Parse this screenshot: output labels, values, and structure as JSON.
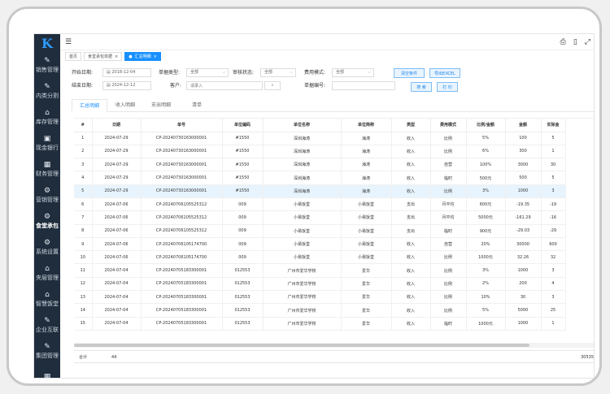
{
  "logo": "K",
  "sidebar": {
    "items": [
      {
        "label": "销售管理",
        "icon": "pen-icon"
      },
      {
        "label": "内类分割",
        "icon": "pen-icon"
      },
      {
        "label": "库存管理",
        "icon": "warehouse-icon"
      },
      {
        "label": "现金银行",
        "icon": "image-icon"
      },
      {
        "label": "财务管理",
        "icon": "calendar-icon"
      },
      {
        "label": "营销管理",
        "icon": "gear-icon"
      },
      {
        "label": "食堂承包",
        "icon": "gear-icon"
      },
      {
        "label": "系统设置",
        "icon": "gear-icon"
      },
      {
        "label": "夹层管理",
        "icon": "warehouse-icon"
      },
      {
        "label": "智慧饭堂",
        "icon": "warehouse-icon"
      },
      {
        "label": "企业互联",
        "icon": "pen-icon"
      },
      {
        "label": "集团管理",
        "icon": "pen-icon"
      },
      {
        "label": "",
        "icon": "grid-icon"
      }
    ]
  },
  "topbar": {
    "menu_icon": "☰",
    "print_icon": "⎙",
    "book_icon": "▯",
    "fullscreen_icon": "⤢"
  },
  "page_tabs": [
    {
      "label": "首页",
      "close": ""
    },
    {
      "label": "食堂承包单据",
      "close": "×"
    },
    {
      "label": "汇总明细",
      "close": "×",
      "dot": "●"
    }
  ],
  "filters": {
    "start_label": "开始日期:",
    "start_value": "2018-12-04",
    "end_label": "结束日期:",
    "end_value": "2024-12-12",
    "doctype_label": "单据类型:",
    "doctype_value": "全部",
    "customer_label": "客户:",
    "customer_placeholder": "请录入",
    "audit_label": "审核状态:",
    "audit_value": "全部",
    "fee_label": "费用模式:",
    "fee_value": "全部",
    "docno_label": "单据编号:",
    "clear_btn": "清空条件",
    "export_btn": "导出EXCEL",
    "search_btn": "搜 索",
    "print_btn": "打 印"
  },
  "subtabs": [
    "汇总明细",
    "收入明细",
    "支出明细",
    "清单"
  ],
  "table": {
    "headers": [
      "#",
      "日期",
      "单号",
      "单位编码",
      "单位名称",
      "单位简称",
      "类型",
      "费用模式",
      "比例/金额",
      "金额",
      "实际金"
    ],
    "rows": [
      [
        "1",
        "2024-07-29",
        "CP-20240730163000001",
        "#1550",
        "深圳海涛",
        "海涛",
        "收入",
        "比例",
        "5%",
        "100",
        "5"
      ],
      [
        "2",
        "2024-07-29",
        "CP-20240730163000001",
        "#1550",
        "深圳海涛",
        "海涛",
        "收入",
        "比例",
        "6%",
        "300",
        "1"
      ],
      [
        "3",
        "2024-07-29",
        "CP-20240730163000001",
        "#1550",
        "深圳海涛",
        "海涛",
        "收入",
        "自营",
        "100%",
        "3000",
        "30"
      ],
      [
        "4",
        "2024-07-29",
        "CP-20240730163000001",
        "#1550",
        "深圳海涛",
        "海涛",
        "收入",
        "临时",
        "500元",
        "500",
        "5"
      ],
      [
        "5",
        "2024-07-29",
        "CP-20240730163000001",
        "#1550",
        "深圳海涛",
        "海涛",
        "收入",
        "比例",
        "3%",
        "1000",
        "3"
      ],
      [
        "6",
        "2024-07-06",
        "CP-20240706105525312",
        "009",
        "小易饭堂",
        "小易饭堂",
        "支出",
        "月平均",
        "600元",
        "-19.35",
        "-19"
      ],
      [
        "7",
        "2024-07-06",
        "CP-20240706105525312",
        "009",
        "小易饭堂",
        "小易饭堂",
        "支出",
        "月平均",
        "5000元",
        "-161.29",
        "-16"
      ],
      [
        "8",
        "2024-07-06",
        "CP-20240706105525312",
        "009",
        "小易饭堂",
        "小易饭堂",
        "支出",
        "临时",
        "900元",
        "-29.03",
        "-29"
      ],
      [
        "9",
        "2024-07-06",
        "CP-20240706105174700",
        "009",
        "小易饭堂",
        "小易饭堂",
        "收入",
        "自营",
        "20%",
        "30000",
        "600"
      ],
      [
        "10",
        "2024-07-06",
        "CP-20240706105174700",
        "009",
        "小易饭堂",
        "小易饭堂",
        "收入",
        "比例",
        "1000元",
        "32.26",
        "32"
      ],
      [
        "11",
        "2024-07-04",
        "CP-20240705183300001",
        "012553",
        "广州市爱华学校",
        "爱华",
        "收入",
        "比例",
        "3%",
        "1000",
        "3"
      ],
      [
        "12",
        "2024-07-04",
        "CP-20240705183300001",
        "012553",
        "广州市爱华学校",
        "爱华",
        "收入",
        "比例",
        "2%",
        "200",
        "4"
      ],
      [
        "13",
        "2024-07-04",
        "CP-20240705183300001",
        "012553",
        "广州市爱华学校",
        "爱华",
        "收入",
        "比例",
        "10%",
        "30",
        "3"
      ],
      [
        "14",
        "2024-07-04",
        "CP-20240705183300001",
        "012553",
        "广州市爱华学校",
        "爱华",
        "收入",
        "比例",
        "5%",
        "5000",
        "25"
      ],
      [
        "15",
        "2024-07-04",
        "CP-20240705183300001",
        "012553",
        "广州市爱华学校",
        "爱华",
        "收入",
        "临时",
        "1000元",
        "1000",
        "1"
      ]
    ],
    "highlight_row": 4
  },
  "footer": {
    "label": "合计",
    "count": "44",
    "total": "30535"
  },
  "colors": {
    "sidebar": "#1f2d3d",
    "accent": "#1890ff",
    "highlight": "#e8f4fd"
  }
}
